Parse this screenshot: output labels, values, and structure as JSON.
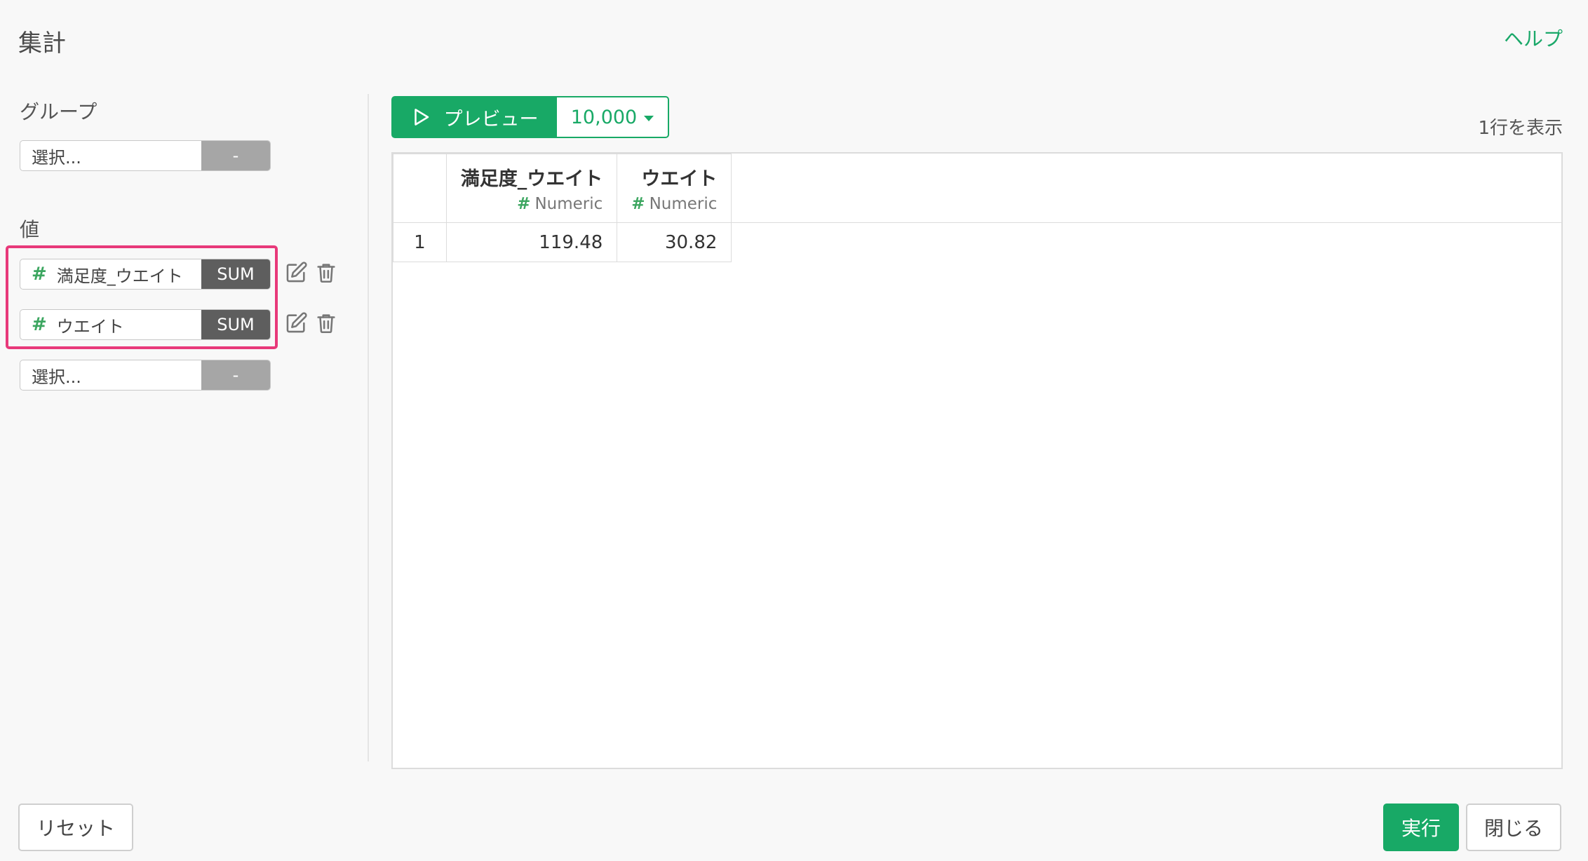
{
  "header": {
    "title": "集計",
    "help_label": "ヘルプ"
  },
  "group_section": {
    "label": "グループ",
    "picker": {
      "placeholder": "選択...",
      "agg_label": "-"
    }
  },
  "value_section": {
    "label": "値",
    "items": [
      {
        "column": "満足度_ウエイト",
        "type_icon": "#",
        "agg": "SUM"
      },
      {
        "column": "ウエイト",
        "type_icon": "#",
        "agg": "SUM"
      }
    ],
    "empty_picker": {
      "placeholder": "選択...",
      "agg_label": "-"
    },
    "row_icons": [
      "edit-icon",
      "trash-icon"
    ]
  },
  "preview": {
    "button_label": "プレビュー",
    "row_limit": "10,000",
    "rows_info": "1行を表示"
  },
  "table": {
    "columns": [
      {
        "name": "満足度_ウエイト",
        "type_icon": "#",
        "type": "Numeric"
      },
      {
        "name": "ウエイト",
        "type_icon": "#",
        "type": "Numeric"
      }
    ],
    "rows": [
      {
        "index": "1",
        "cells": [
          "119.48",
          "30.82"
        ]
      }
    ]
  },
  "footer": {
    "reset_label": "リセット",
    "run_label": "実行",
    "close_label": "閉じる"
  },
  "colors": {
    "accent": "#18a966",
    "highlight": "#e8397a",
    "agg_sum": "#5e5e5e",
    "agg_empty": "#a6a6a6"
  }
}
